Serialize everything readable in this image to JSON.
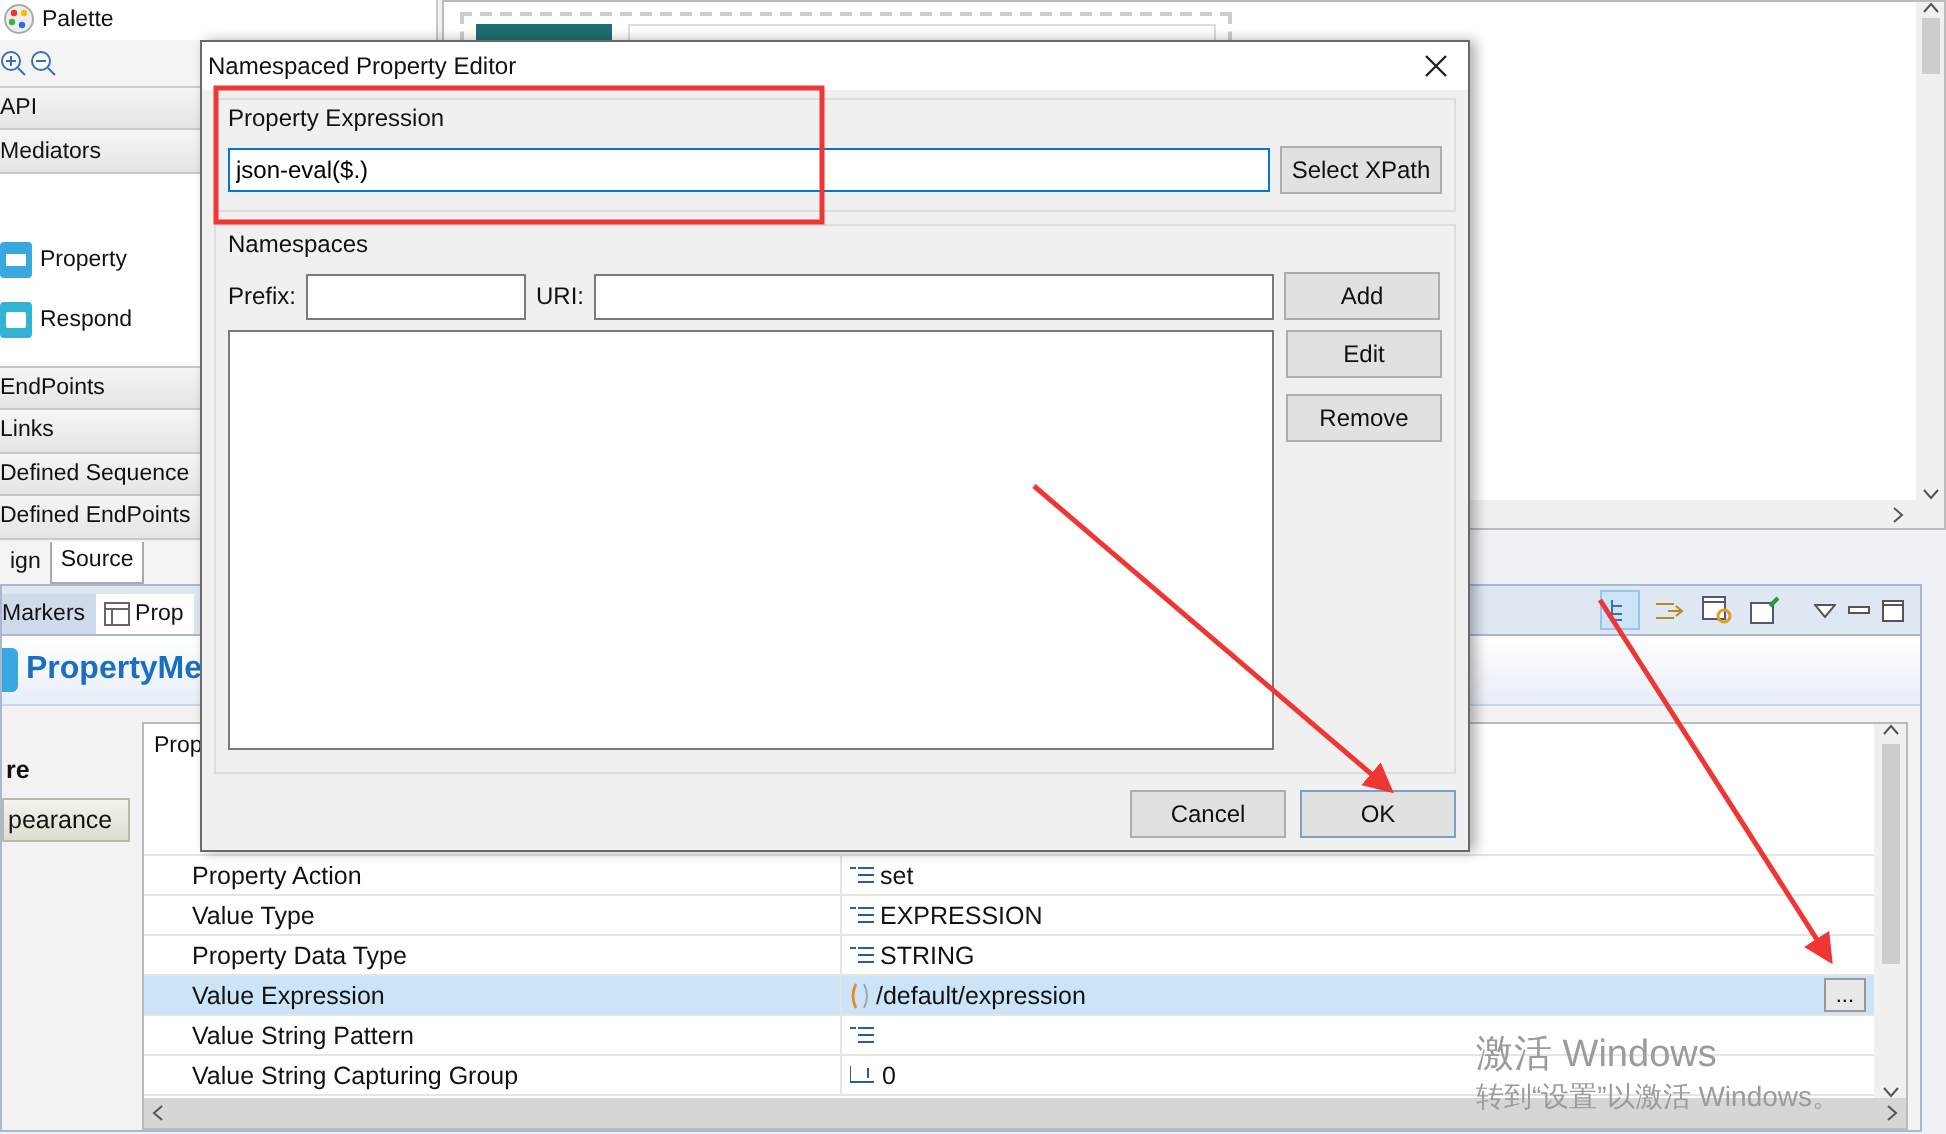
{
  "palette": {
    "title": "Palette",
    "top_drawers": [
      "API",
      "Mediators"
    ],
    "tools": [
      {
        "label": "Property",
        "kind": "property"
      },
      {
        "label": "Respond",
        "kind": "respond"
      }
    ],
    "bottom_drawers": [
      "EndPoints",
      "Links",
      "Defined Sequence",
      "Defined EndPoints"
    ]
  },
  "editor_tabs": [
    {
      "label": "ign",
      "selected": false
    },
    {
      "label": "Source",
      "selected": true
    }
  ],
  "views": {
    "tabs": [
      {
        "label": "Markers",
        "selected": false
      },
      {
        "label": "Prop",
        "selected": true
      }
    ],
    "title": "PropertyMe",
    "sections": [
      {
        "label": "re",
        "selected": true
      },
      {
        "label": "pearance",
        "selected": false
      }
    ],
    "table": {
      "column_1": "Prop",
      "rows": [
        {
          "name": "Property Action",
          "value": "set",
          "kind": "list",
          "selected": false
        },
        {
          "name": "Value Type",
          "value": "EXPRESSION",
          "kind": "list",
          "selected": false
        },
        {
          "name": "Property Data Type",
          "value": "STRING",
          "kind": "list",
          "selected": false
        },
        {
          "name": "Value Expression",
          "value": "/default/expression",
          "kind": "expression",
          "selected": true,
          "button": "..."
        },
        {
          "name": "Value String Pattern",
          "kind": "list",
          "selected": false
        },
        {
          "name": "Value String Capturing Group",
          "value": "0",
          "kind": "number",
          "selected": false
        }
      ]
    }
  },
  "dialog": {
    "title": "Namespaced Property Editor",
    "expression_group": {
      "label": "Property Expression",
      "value": "json-eval($.)",
      "button": "Select XPath"
    },
    "namespaces_group": {
      "label": "Namespaces",
      "prefix_label": "Prefix:",
      "uri_label": "URI:",
      "buttons": [
        "Add",
        "Edit",
        "Remove"
      ]
    },
    "buttons": [
      {
        "label": "Cancel",
        "default": false
      },
      {
        "label": "OK",
        "default": true
      }
    ]
  },
  "activation_notice": {
    "title": "激活 Windows",
    "subtitle": "转到“设置”以激活 Windows。"
  }
}
